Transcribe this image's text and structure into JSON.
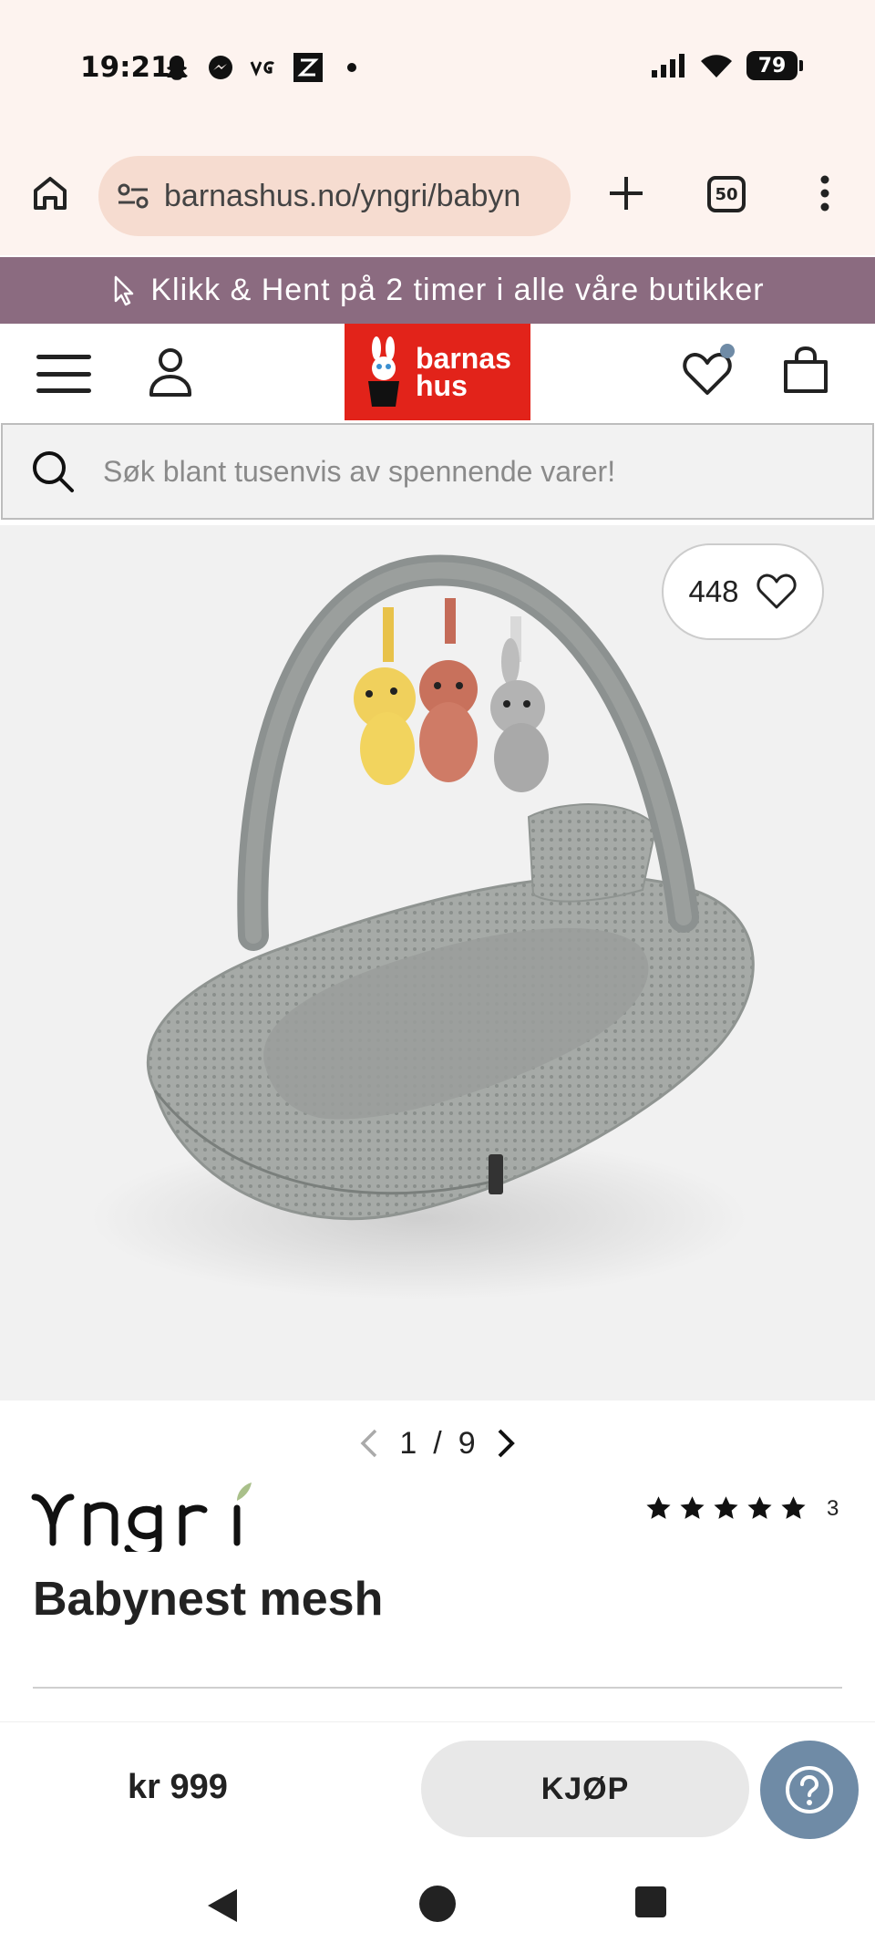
{
  "status_bar": {
    "time": "19:21",
    "notification_icons": [
      "snapchat-icon",
      "messenger-icon",
      "vg-icon",
      "z-icon",
      "dot-icon"
    ],
    "battery": "79"
  },
  "browser": {
    "url": "barnashus.no/yngri/babyn",
    "tab_count": "50"
  },
  "promo_banner": {
    "text": "Klikk & Hent på 2 timer i alle våre butikker"
  },
  "header": {
    "logo_line1": "barnas",
    "logo_line2": "hus"
  },
  "search": {
    "placeholder": "Søk blant tusenvis av spennende varer!"
  },
  "gallery": {
    "likes": "448",
    "current": "1",
    "separator": "/",
    "total": "9"
  },
  "product": {
    "brand": "Yngri",
    "title": "Babynest mesh",
    "rating_stars": 5,
    "rating_count": "3"
  },
  "buy_bar": {
    "price": "kr 999",
    "buy_label": "KJØP"
  },
  "colors": {
    "banner": "#8b6b80",
    "logo": "#e2231a",
    "accent": "#6f8ba6",
    "browser_bg": "#fdf3ef"
  }
}
